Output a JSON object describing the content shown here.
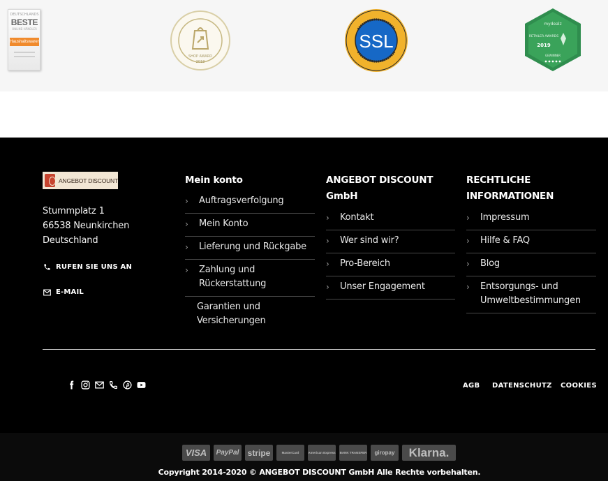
{
  "awards": {
    "beste": {
      "small_top": "DEUTSCHLANDS",
      "title": "BESTE",
      "small_sub": "ONLINE-HÄNDLER",
      "band": "Haushaltswaren",
      "icon": "beste-online-haendler-seal"
    },
    "internet_world": {
      "ring_text": "INTERNET WORLD BUSINESS",
      "bottom": "SHOP AWARD",
      "year": "2018",
      "icon": "internet-world-shop-award-seal"
    },
    "ssl": {
      "label": "SSL",
      "ring_text": "DATENSICHERHEIT",
      "icon": "ssl-security-seal"
    },
    "retailer": {
      "brand": "mydealz",
      "title": "RETAILER AWARDS",
      "year": "2019",
      "sub": "GEWINNER",
      "icon": "retailer-award-badge"
    }
  },
  "footer": {
    "logo_text": "ANGEBOT DISCOUNT",
    "address": [
      "Stummplatz 1",
      "66538 Neunkirchen",
      "Deutschland"
    ],
    "call_label": "RUFEN SIE UNS AN",
    "email_label": "E-MAIL",
    "col_account": {
      "title": "Mein konto",
      "items": [
        "Auftragsverfolgung",
        "Mein Konto",
        "Lieferung und Rückgabe",
        "Zahlung und Rückerstattung",
        "Garantien und Versicherungen"
      ]
    },
    "col_company": {
      "title": "ANGEBOT DISCOUNT GmbH",
      "items": [
        "Kontakt",
        "Wer sind wir?",
        "Pro-Bereich",
        "Unser Engagement"
      ]
    },
    "col_legal": {
      "title": "RECHTLICHE INFORMATIONEN",
      "items": [
        "Impressum",
        "Hilfe & FAQ",
        "Blog",
        "Entsorgungs- und Umweltbestimmungen"
      ]
    },
    "social_icons": [
      "facebook-icon",
      "instagram-icon",
      "email-icon",
      "phone-icon",
      "pinterest-icon",
      "youtube-icon"
    ],
    "bottom_links": [
      "AGB",
      "DATENSCHUTZ",
      "COOKIES"
    ]
  },
  "payments": [
    "VISA",
    "PayPal",
    "stripe",
    "MasterCard",
    "American Express",
    "BANK TRANSFER",
    "giropay",
    "Klarna."
  ],
  "copyright": "Copyright 2014-2020 © ANGEBOT DISCOUNT GmbH Alle Rechte vorbehalten."
}
